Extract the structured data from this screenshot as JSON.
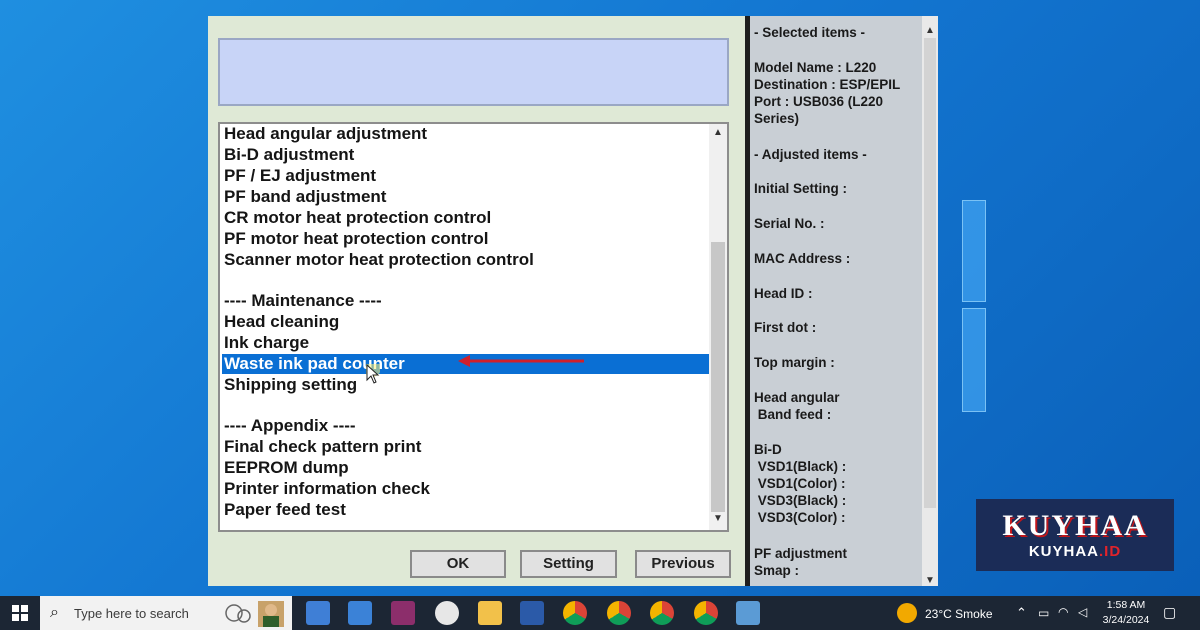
{
  "dialog": {
    "list_items": [
      "Head angular adjustment",
      "Bi-D adjustment",
      "PF / EJ adjustment",
      "PF band adjustment",
      "CR motor heat protection control",
      "PF motor heat protection control",
      "Scanner motor heat protection control",
      "",
      "---- Maintenance ----",
      "Head cleaning",
      "Ink charge",
      "Waste ink pad counter",
      "Shipping setting",
      "",
      "---- Appendix ----",
      "Final check pattern print",
      "EEPROM dump",
      "Printer information check",
      "Paper feed test"
    ],
    "selected_item": "Waste ink pad counter",
    "buttons": {
      "ok": "OK",
      "setting": "Setting",
      "previous": "Previous"
    },
    "arrow_color": "#d01f2a",
    "selection_color": "#0a6fd4"
  },
  "side_panel": {
    "selected_header": "- Selected items -",
    "model": "Model Name : L220",
    "destination": "Destination : ESP/EPIL",
    "port": "Port : USB036 (L220\nSeries)",
    "adjusted_header": "- Adjusted items -",
    "initial_setting": "Initial Setting :",
    "serial_no": "Serial No. :",
    "mac_address": "MAC Address :",
    "head_id": "Head ID :",
    "first_dot": "First dot :",
    "top_margin": "Top margin :",
    "head_angular": "Head angular\n Band feed :",
    "bid": "Bi-D\n VSD1(Black) :\n VSD1(Color) :\n VSD3(Black) :\n VSD3(Color) :",
    "pf_adjustment": "PF adjustment\nSmap :"
  },
  "watermark": {
    "main": "KUYHAA",
    "sub_left": "KUYHAA",
    "sub_right": ".ID"
  },
  "taskbar": {
    "search_placeholder": "Type here to search",
    "weather": "23°C  Smoke",
    "time": "1:58 AM",
    "date": "3/24/2024",
    "apps": [
      "task-view-icon",
      "store-icon",
      "mail-icon",
      "winrar-icon",
      "paint-icon",
      "file-explorer-icon",
      "word-icon",
      "chrome-icon",
      "chrome-profile-icon",
      "chrome-b-icon",
      "chrome-k-icon",
      "control-panel-icon"
    ]
  }
}
